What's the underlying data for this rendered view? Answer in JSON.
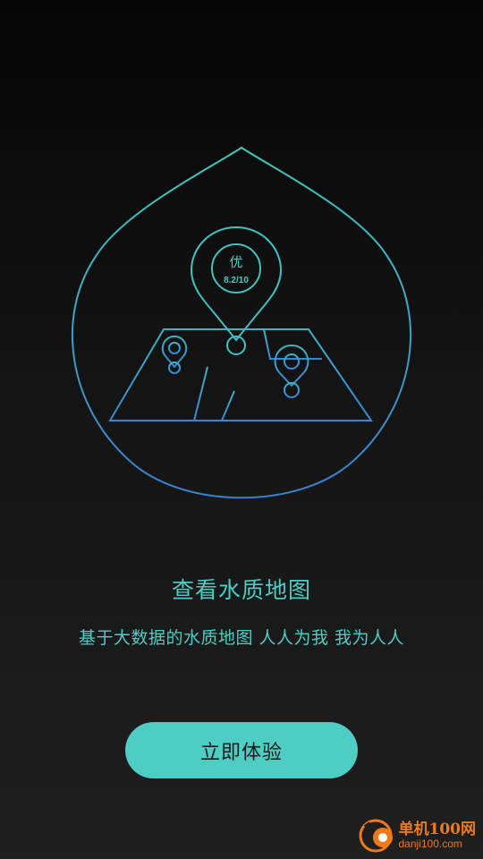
{
  "hero": {
    "pin_grade": "优",
    "pin_score": "8.2/10",
    "icon": "water-drop-map-icon"
  },
  "content": {
    "title": "查看水质地图",
    "subtitle": "基于大数据的水质地图 人人为我 我为人人"
  },
  "cta": {
    "label": "立即体验"
  },
  "watermark": {
    "name": "单机100网",
    "url": "danji100.com"
  },
  "colors": {
    "accent": "#4ecdc4",
    "drop_top": "#3fc9b8",
    "drop_bottom": "#3a7fd0",
    "background_top": "#060606",
    "background_bottom": "#1f1f1f",
    "watermark": "#f07a1a"
  }
}
